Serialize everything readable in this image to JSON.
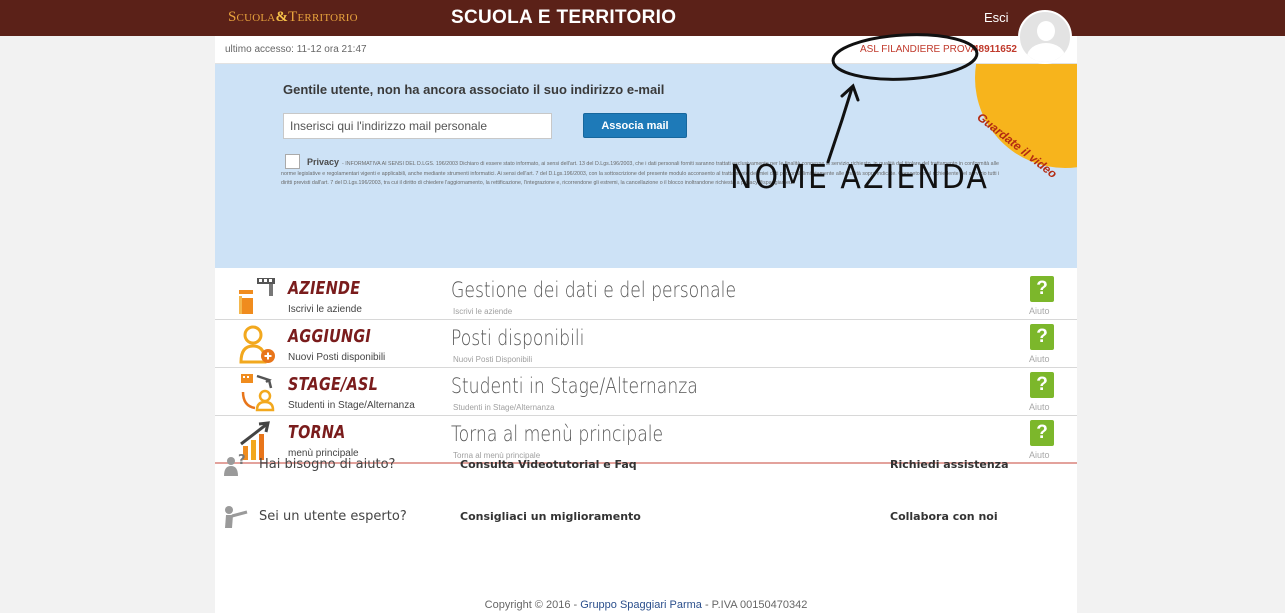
{
  "header": {
    "logo_part1": "Scuola",
    "logo_amp": "&",
    "logo_part2": "Territorio",
    "title": "SCUOLA E TERRITORIO",
    "logout_label": "Esci"
  },
  "access": {
    "last_access": "ultimo accesso: 11-12 ora 21:47",
    "company_name": "ASL FILANDIERE PROVA",
    "company_code": "48911652"
  },
  "email_notice": {
    "title": "Gentile utente, non ha ancora associato il suo indirizzo e-mail",
    "input_placeholder": "Inserisci qui l'indirizzo mail personale",
    "input_value": "",
    "button_label": "Associa mail",
    "privacy_label": "Privacy",
    "privacy_text": "- INFORMATIVA AI SENSI DEL D.LGS. 196/2003 Dichiaro di essere stato informato, ai sensi dell'art. 13 del D.Lgs.196/2003, che i dati personali forniti saranno trattati esclusivamente per le finalità connesse al servizio richiesto, in qualità del titolare del trattamento in conformità alle norme legislative e regolamentari vigenti e applicabili, anche mediante strumenti informatici. Ai sensi dell'art. 7 del D.Lgs.196/2003, con la sottoscrizione del presente modulo acconsento al trattamento dei miei dati personali limitatamente alle finalità sopra indicate. Competono al richiedente del servizio tutti i diritti previsti dall'art. 7 del D.Lgs.196/2003, tra cui il diritto di chiedere l'aggiornamento, la rettificazione, l'integrazione e, ricorrendone gli estremi, la cancellazione o il blocco inoltrandone richiesta a privacy@spaggiari.eu",
    "video_badge": "Guardate il video"
  },
  "annotation": {
    "text": "NOME AZIENDA"
  },
  "menu": [
    {
      "name": "AZIENDE",
      "subtitle": "Iscrivi le aziende",
      "title": "Gestione dei dati e del personale",
      "description": "Iscrivi le aziende",
      "help_symbol": "?",
      "help_label": "Aiuto"
    },
    {
      "name": "AGGIUNGI",
      "subtitle": "Nuovi Posti disponibili",
      "title": "Posti disponibili",
      "description": "Nuovi Posti Disponibili",
      "help_symbol": "?",
      "help_label": "Aiuto"
    },
    {
      "name": "STAGE/ASL",
      "subtitle": "Studenti in Stage/Alternanza",
      "title": "Studenti in Stage/Alternanza",
      "description": "Studenti in Stage/Alternanza",
      "help_symbol": "?",
      "help_label": "Aiuto"
    },
    {
      "name": "TORNA",
      "subtitle": "menù principale",
      "title": "Torna al menù principale",
      "description": "Torna al menù principale",
      "help_symbol": "?",
      "help_label": "Aiuto"
    }
  ],
  "assistance": {
    "help_question": "Hai bisogno di aiuto?",
    "tutorial_link": "Consulta Videotutorial e Faq",
    "support_link": "Richiedi assistenza",
    "expert_question": "Sei un utente esperto?",
    "suggest_link": "Consigliaci un miglioramento",
    "collaborate_link": "Collabora con noi"
  },
  "footer": {
    "copyright": "Copyright © 2016 - ",
    "company": "Gruppo Spaggiari Parma",
    "vat": " - P.IVA 00150470342"
  },
  "colors": {
    "topbar": "#5b2118",
    "notice_bg": "#cde2f6",
    "primary_button": "#1e7ab8",
    "menu_name": "#7a1c1c",
    "help_button": "#7cb72b",
    "video_badge": "#f7b41c",
    "company_text": "#c0392b"
  },
  "icons": {
    "aziende": "buildings-icon",
    "aggiungi": "add-person-icon",
    "stage": "transfer-person-icon",
    "torna": "growth-chart-icon",
    "help": "person-question-icon",
    "expert": "person-pointing-icon"
  }
}
